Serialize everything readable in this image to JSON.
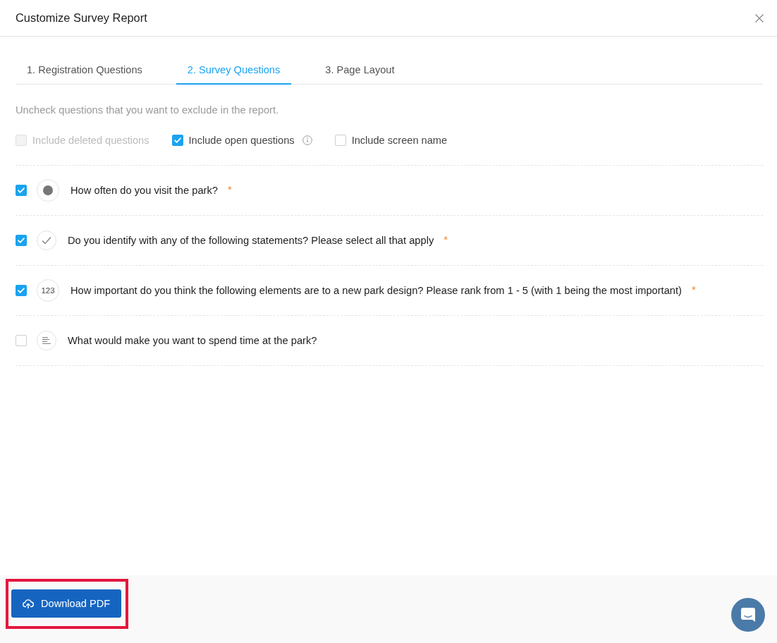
{
  "dialog": {
    "title": "Customize Survey Report"
  },
  "tabs": [
    {
      "label": "1. Registration Questions",
      "selected": false
    },
    {
      "label": "2. Survey Questions",
      "selected": true
    },
    {
      "label": "3. Page Layout",
      "selected": false
    }
  ],
  "hint": "Uncheck questions that you want to exclude in the report.",
  "options": [
    {
      "label": "Include deleted questions",
      "checked": false,
      "disabled": true,
      "info": false
    },
    {
      "label": "Include open questions",
      "checked": true,
      "disabled": false,
      "info": true
    },
    {
      "label": "Include screen name",
      "checked": false,
      "disabled": false,
      "info": false
    }
  ],
  "questions": [
    {
      "kind": "single-choice",
      "text": "How often do you visit the park?",
      "checked": true,
      "required_mark": "*"
    },
    {
      "kind": "multiple-choice",
      "text": "Do you identify with any of the following statements? Please select all that apply",
      "checked": true,
      "required_mark": "*"
    },
    {
      "kind": "ranking",
      "icon_label": "123",
      "text": "How important do you think the following elements are to a new park design? Please rank from 1 - 5 (with 1 being the most important)",
      "checked": true,
      "required_mark": "*"
    },
    {
      "kind": "open-text",
      "text": "What would make you want to spend time at the park?",
      "checked": false
    }
  ],
  "footer": {
    "download_button": {
      "label": "Download PDF",
      "highlighted": true
    }
  }
}
